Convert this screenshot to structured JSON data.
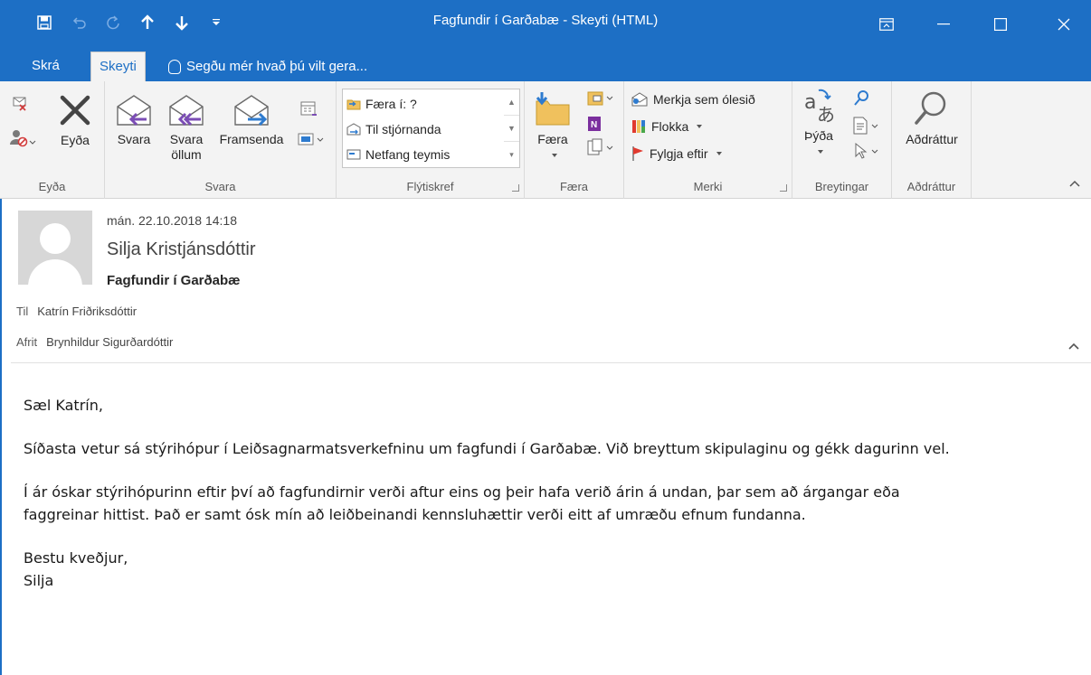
{
  "window": {
    "title": "Fagfundir í Garðabæ - Skeyti (HTML)"
  },
  "tabs": {
    "file": "Skrá",
    "message": "Skeyti",
    "tell_me": "Segðu mér hvað þú vilt gera..."
  },
  "ribbon": {
    "delete_group": {
      "label": "Eyða",
      "delete_button": "Eyða"
    },
    "respond_group": {
      "label": "Svara",
      "reply": "Svara",
      "reply_all_line1": "Svara",
      "reply_all_line2": "öllum",
      "forward": "Framsenda"
    },
    "quick_steps_group": {
      "label": "Flýtiskref",
      "items": [
        "Færa í: ?",
        "Til stjórnanda",
        "Netfang teymis"
      ]
    },
    "move_group": {
      "label": "Færa",
      "move_button": "Færa"
    },
    "tags_group": {
      "label": "Merki",
      "mark_unread": "Merkja sem ólesið",
      "categorize": "Flokka",
      "follow_up": "Fylgja eftir"
    },
    "editing_group": {
      "label": "Breytingar",
      "translate": "Þýða"
    },
    "zoom_group": {
      "label": "Aðdráttur",
      "zoom_button": "Aðdráttur"
    }
  },
  "message": {
    "date": "mán. 22.10.2018 14:18",
    "sender": "Silja Kristjánsdóttir",
    "subject": "Fagfundir í Garðabæ",
    "to_label": "Til",
    "to": "Katrín Friðriksdóttir",
    "cc_label": "Afrit",
    "cc": "Brynhildur Sigurðardóttir",
    "body": {
      "greeting": "Sæl Katrín,",
      "paragraph1": "Síðasta vetur sá stýrihópur í Leiðsagnarmatsverkefninu um fagfundi í Garðabæ. Við breyttum skipulaginu og gékk dagurinn vel.",
      "paragraph2": "Í ár óskar stýrihópurinn eftir því að fagfundirnir verði aftur eins og þeir hafa verið árin á undan, þar sem að árgangar eða\nfaggreinar hittist. Það er samt ósk mín að leiðbeinandi kennsluhættir verði eitt af umræðu efnum fundanna.",
      "signoff": "Bestu kveðjur,\nSilja"
    }
  },
  "colors": {
    "accent": "#1d6fc5",
    "ribbon_bg": "#f3f3f3",
    "reply_arrow": "#7b4db5",
    "forward_arrow": "#2e7bcf",
    "delete_x": "#444444",
    "flag": "#e03a2f"
  }
}
